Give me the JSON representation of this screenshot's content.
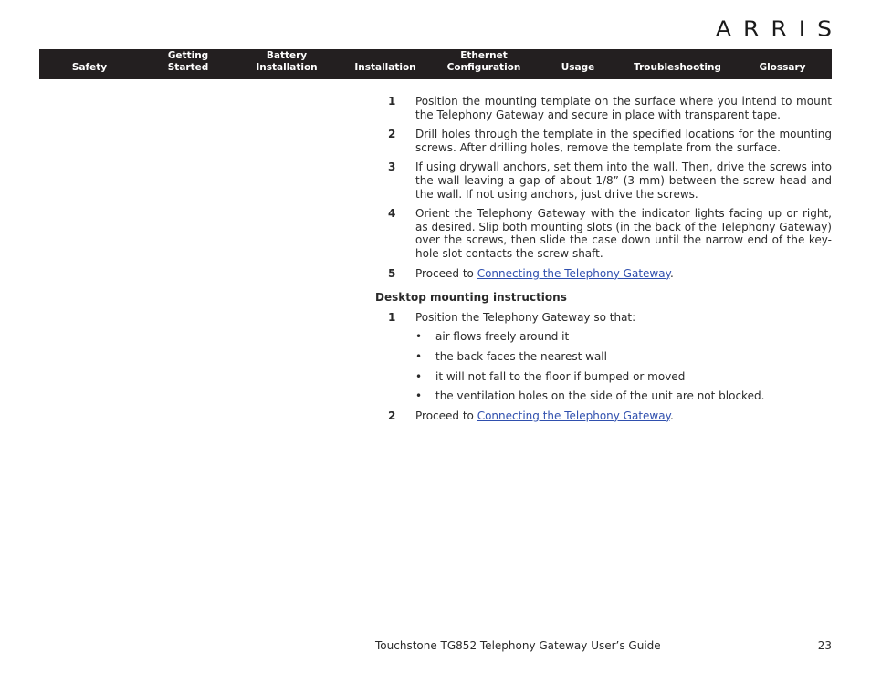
{
  "header": {
    "logo_text": "ARRIS"
  },
  "nav": {
    "items": [
      {
        "line1": "",
        "line2": "Safety"
      },
      {
        "line1": "Getting",
        "line2": "Started"
      },
      {
        "line1": "Battery",
        "line2": "Installation"
      },
      {
        "line1": "",
        "line2": "Installation"
      },
      {
        "line1": "Ethernet",
        "line2": "Configuration"
      },
      {
        "line1": "",
        "line2": "Usage"
      },
      {
        "line1": "",
        "line2": "Troubleshooting"
      },
      {
        "line1": "",
        "line2": "Glossary"
      }
    ]
  },
  "wall_steps": [
    {
      "num": "1",
      "text": "Position the mounting template on the surface where you intend to mount the Telephony Gateway and secure in place with transparent tape."
    },
    {
      "num": "2",
      "text": "Drill holes through the template in the specified locations for the mounting screws. After drilling holes, remove the template from the surface."
    },
    {
      "num": "3",
      "text": "If using drywall anchors, set them into the wall. Then, drive the screws into the wall leaving a gap of about 1/8” (3 mm) between the screw head and the wall. If not using anchors, just drive the screws."
    },
    {
      "num": "4",
      "text": "Orient the Telephony Gateway with the indicator lights facing up or right, as desired. Slip both mounting slots (in the back of the Telephony Gateway) over the screws, then slide the case down until the narrow end of the key-hole slot contacts the screw shaft."
    },
    {
      "num": "5",
      "text_before": "Proceed to ",
      "link": "Connecting the Telephony Gateway",
      "text_after": "."
    }
  ],
  "desktop": {
    "heading": "Desktop mounting instructions",
    "step1": {
      "num": "1",
      "text": "Position the Telephony Gateway so that:"
    },
    "bullets": [
      "air flows freely around it",
      "the back faces the nearest wall",
      "it will not fall to the floor if bumped or moved",
      "the ventilation holes on the side of the unit are not blocked."
    ],
    "bullet_glyph": "•",
    "step2": {
      "num": "2",
      "text_before": "Proceed to ",
      "link": "Connecting the Telephony Gateway",
      "text_after": "."
    }
  },
  "footer": {
    "title": "Touchstone TG852 Telephony Gateway User’s Guide",
    "page": "23"
  }
}
